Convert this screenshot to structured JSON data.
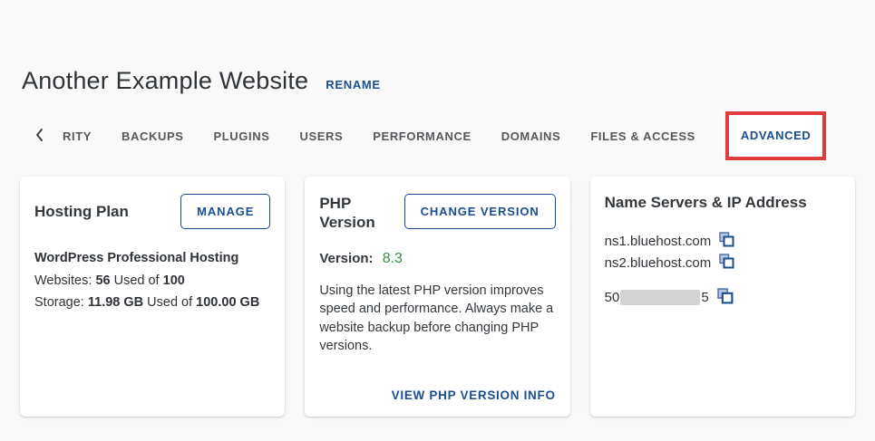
{
  "page": {
    "title": "Another Example Website",
    "rename_label": "RENAME"
  },
  "tabs": {
    "items": [
      {
        "label": "RITY"
      },
      {
        "label": "BACKUPS"
      },
      {
        "label": "PLUGINS"
      },
      {
        "label": "USERS"
      },
      {
        "label": "PERFORMANCE"
      },
      {
        "label": "DOMAINS"
      },
      {
        "label": "FILES & ACCESS"
      },
      {
        "label": "ADVANCED",
        "active": true,
        "annotated_with_red_box": true
      }
    ]
  },
  "cards": {
    "hosting_plan": {
      "title": "Hosting Plan",
      "button_label": "MANAGE",
      "plan_name": "WordPress Professional Hosting",
      "websites": {
        "label": "Websites:",
        "used": "56",
        "of": "Used of",
        "total": "100"
      },
      "storage": {
        "label": "Storage:",
        "used": "11.98 GB",
        "of": "Used of",
        "total": "100.00 GB"
      }
    },
    "php_version": {
      "title": "PHP Version",
      "button_label": "CHANGE VERSION",
      "version_label": "Version:",
      "version_value": "8.3",
      "description": "Using the latest PHP version improves speed and performance. Always make a website backup before changing PHP versions.",
      "link_label": "VIEW PHP VERSION INFO"
    },
    "name_servers": {
      "title": "Name Servers & IP Address",
      "nameservers": [
        "ns1.bluehost.com",
        "ns2.bluehost.com"
      ],
      "ip": {
        "prefix": "50",
        "suffix": "5",
        "redacted_middle": true
      }
    }
  },
  "icons": {
    "chevron_left": "tabs scroll-left chevron",
    "copy": "copy-to-clipboard (two overlapping squares)"
  },
  "colors": {
    "accent_blue": "#1b4e91",
    "version_green": "#388e3c",
    "annotation_red": "#e13b3b",
    "page_background": "#f9f9f9",
    "card_background": "#ffffff",
    "tab_inactive_text": "#55585c",
    "redaction_gray": "#d3d3d3"
  }
}
